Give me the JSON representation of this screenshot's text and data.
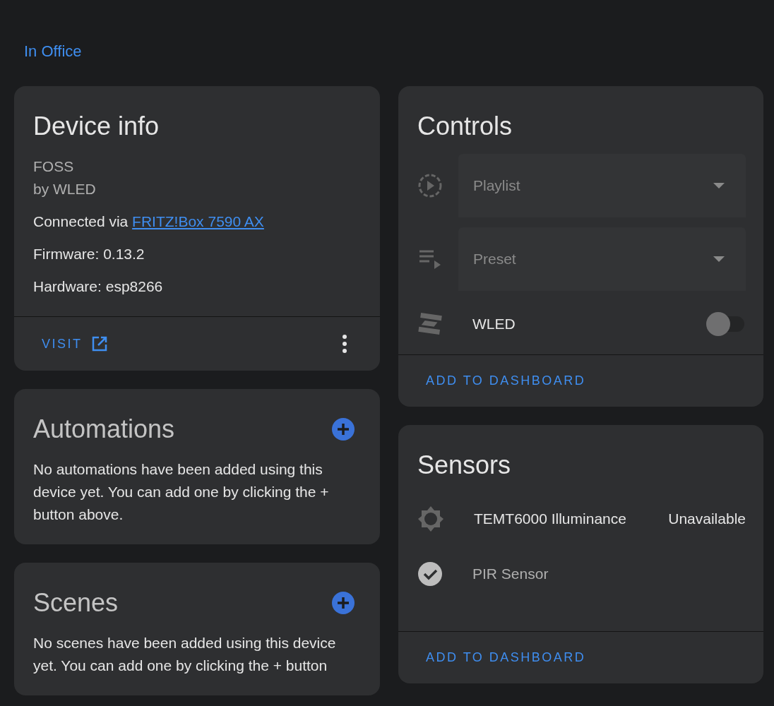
{
  "breadcrumb": "In Office",
  "device_info": {
    "title": "Device info",
    "model": "FOSS",
    "manufacturer": "by WLED",
    "connection_prefix": "Connected via",
    "connection_link": "FRITZ!Box 7590 AX",
    "firmware": "Firmware: 0.13.2",
    "hardware": "Hardware: esp8266",
    "visit_button": "VISIT"
  },
  "automations": {
    "title": "Automations",
    "text": "No automations have been added using this device yet. You can add one by clicking the + button above."
  },
  "scenes": {
    "title": "Scenes",
    "text": "No scenes have been added using this device yet. You can add one by clicking the + button"
  },
  "controls": {
    "title": "Controls",
    "items": [
      {
        "kind": "select",
        "label": "Playlist",
        "disabled": true
      },
      {
        "kind": "select",
        "label": "Preset",
        "disabled": true
      },
      {
        "kind": "switch",
        "label": "WLED",
        "on": false
      }
    ],
    "action": "ADD TO DASHBOARD"
  },
  "sensors": {
    "title": "Sensors",
    "items": [
      {
        "label": "TEMT6000 Illuminance",
        "value": "Unavailable",
        "disabled": false
      },
      {
        "label": "PIR Sensor",
        "disabled": true
      }
    ],
    "action": "ADD TO DASHBOARD"
  }
}
